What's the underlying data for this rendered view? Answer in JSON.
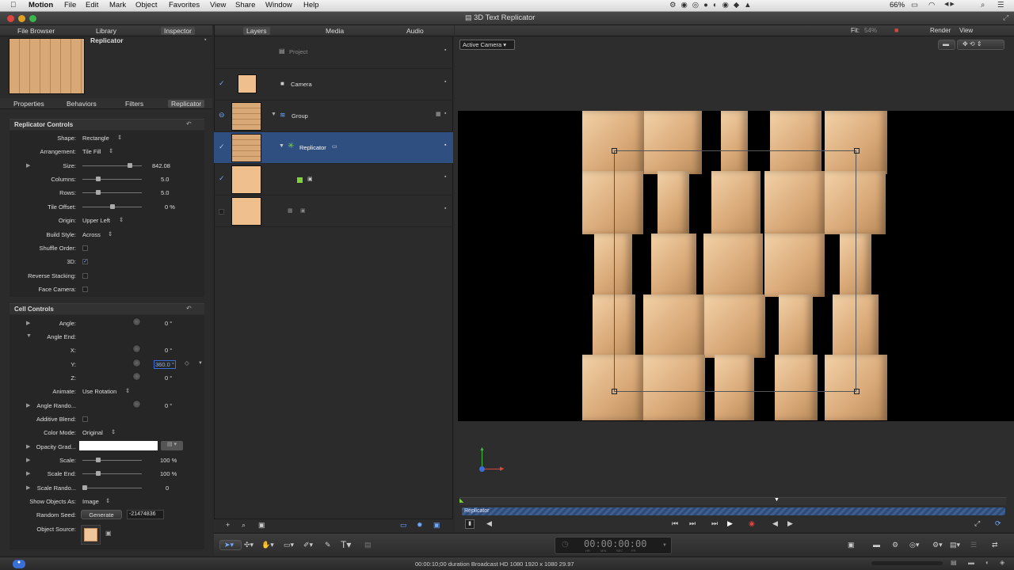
{
  "menubar": {
    "apple": "",
    "items": [
      "Motion",
      "File",
      "Edit",
      "Mark",
      "Object",
      "Favorites",
      "View",
      "Share",
      "Window",
      "Help"
    ],
    "battery": "66%",
    "clock": "◀ ▶"
  },
  "window": {
    "title": "3D Text Replicator"
  },
  "left_tabs": [
    "File Browser",
    "Library",
    "Inspector"
  ],
  "preview_title": "Replicator",
  "inspector_tabs": [
    "Properties",
    "Behaviors",
    "Filters",
    "Replicator"
  ],
  "replicator_controls": {
    "header": "Replicator Controls",
    "rows": [
      {
        "label": "Shape:",
        "value": "Rectangle"
      },
      {
        "label": "Arrangement:",
        "value": "Tile Fill"
      },
      {
        "label": "Size:",
        "value": "842.08"
      },
      {
        "label": "Columns:",
        "value": "5.0"
      },
      {
        "label": "Rows:",
        "value": "5.0"
      },
      {
        "label": "Tile Offset:",
        "value": "0 %"
      },
      {
        "label": "Origin:",
        "value": "Upper Left"
      },
      {
        "label": "Build Style:",
        "value": "Across"
      },
      {
        "label": "Shuffle Order:",
        "value": ""
      },
      {
        "label": "3D:",
        "value": "✓"
      },
      {
        "label": "Reverse Stacking:",
        "value": ""
      },
      {
        "label": "Face Camera:",
        "value": ""
      }
    ]
  },
  "cell_controls": {
    "header": "Cell Controls",
    "rows": [
      {
        "label": "Angle:",
        "value": "0 °"
      },
      {
        "label": "Angle End:",
        "value": ""
      },
      {
        "label": "X:",
        "value": "0 °"
      },
      {
        "label": "Y:",
        "value": "360.0 °"
      },
      {
        "label": "Z:",
        "value": "0 °"
      },
      {
        "label": "Animate:",
        "value": "Use Rotation"
      },
      {
        "label": "Angle Rando...",
        "value": "0 °"
      },
      {
        "label": "Additive Blend:",
        "value": ""
      },
      {
        "label": "Color Mode:",
        "value": "Original"
      },
      {
        "label": "Opacity Grad...",
        "value": ""
      },
      {
        "label": "Scale:",
        "value": "100 %"
      },
      {
        "label": "Scale End:",
        "value": "100 %"
      },
      {
        "label": "Scale Rando...",
        "value": "0"
      },
      {
        "label": "Show Objects As:",
        "value": "Image"
      },
      {
        "label": "Random Seed:",
        "value": "-21474836"
      },
      {
        "label": "Object Source:",
        "value": ""
      }
    ],
    "generate_label": "Generate"
  },
  "mid_tabs": [
    "Layers",
    "Media",
    "Audio"
  ],
  "layers": [
    {
      "name": "Project"
    },
    {
      "name": "Camera"
    },
    {
      "name": "Group"
    },
    {
      "name": "Replicator"
    },
    {
      "name": ""
    },
    {
      "name": ""
    }
  ],
  "canvas": {
    "fit_label": "Fit:",
    "fit_value": "54%",
    "render_label": "Render",
    "view_label": "View",
    "camera_label": "Active Camera"
  },
  "timeline": {
    "clip_label": "Replicator",
    "timecode": "00:00:00:00",
    "timecode_units": [
      "HR",
      "MIN",
      "SEC",
      "FR"
    ]
  },
  "status": {
    "text": "00:00:10;00 duration Broadcast HD 1080 1920 x 1080 29.97"
  },
  "colors": {
    "accent": "#3a6fd8",
    "selection": "#2e4f80",
    "material": "#d9a877"
  }
}
